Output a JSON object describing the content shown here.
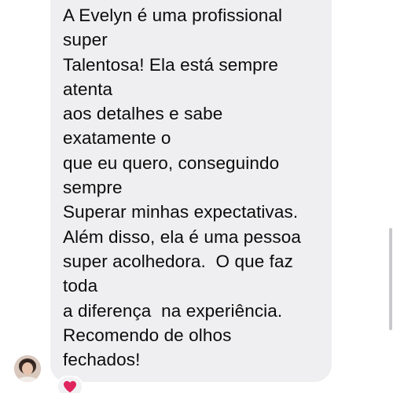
{
  "message": {
    "lines": [
      "A Evelyn é uma profissional",
      "super",
      "Talentosa! Ela está sempre",
      "atenta",
      "aos detalhes e sabe",
      "exatamente o",
      "que eu quero, conseguindo",
      "sempre",
      "Superar minhas expectativas.",
      "Além disso, ela é uma pessoa",
      "super acolhedora.  O que faz",
      "toda",
      "a diferença  na experiência.",
      "Recomendo de olhos",
      "fechados!"
    ]
  },
  "sender": {
    "avatar_icon": "profile-photo"
  },
  "reaction": {
    "icon": "heart-icon",
    "color": "#e0245e"
  },
  "colors": {
    "bubble": "#efeff1",
    "text": "#0b0b0b",
    "background": "#ffffff"
  }
}
